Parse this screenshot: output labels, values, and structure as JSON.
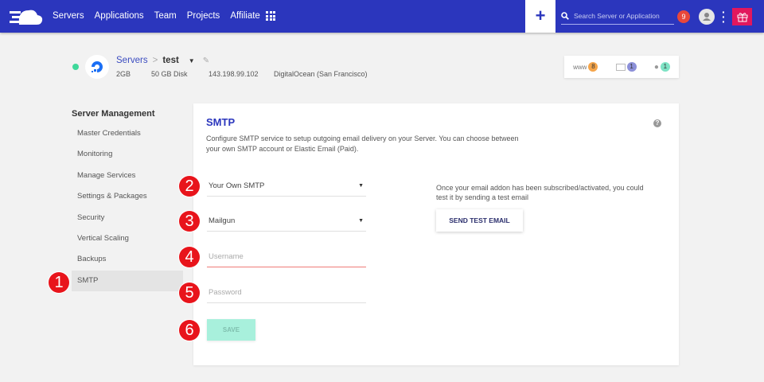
{
  "topbar": {
    "nav": [
      "Servers",
      "Applications",
      "Team",
      "Projects",
      "Affiliate"
    ],
    "search_placeholder": "Search Server or Application",
    "notifications": "9",
    "plus": "+"
  },
  "server": {
    "breadcrumb_root": "Servers",
    "separator": ">",
    "name": "test",
    "ram": "2GB",
    "disk": "50 GB Disk",
    "ip": "143.198.99.102",
    "provider": "DigitalOcean (San Francisco)",
    "status_color": "#3fd89a"
  },
  "counters": [
    {
      "label": "www",
      "count": "8",
      "color": "#f5a54a"
    },
    {
      "label": "",
      "count": "1",
      "color": "#8c90d9"
    },
    {
      "label": "",
      "count": "1",
      "color": "#7ee3c5"
    }
  ],
  "sidebar": {
    "title": "Server Management",
    "items": [
      "Master Credentials",
      "Monitoring",
      "Manage Services",
      "Settings & Packages",
      "Security",
      "Vertical Scaling",
      "Backups",
      "SMTP"
    ],
    "active": "SMTP"
  },
  "smtp": {
    "title": "SMTP",
    "description": "Configure SMTP service to setup outgoing email delivery on your Server. You can choose between your own SMTP account or Elastic Email (Paid).",
    "help": "?",
    "provider_type": "Your Own SMTP",
    "provider": "Mailgun",
    "username_placeholder": "Username",
    "password_placeholder": "Password",
    "save": "SAVE",
    "test_note": "Once your email addon has been subscribed/activated, you could test it by sending a test email",
    "test_button": "SEND TEST EMAIL"
  },
  "steps": [
    "1",
    "2",
    "3",
    "4",
    "5",
    "6"
  ]
}
